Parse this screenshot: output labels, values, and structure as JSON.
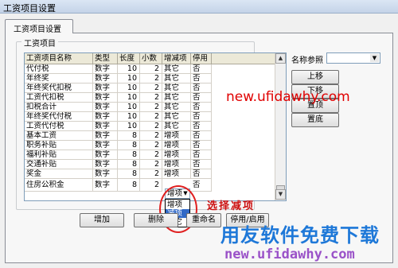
{
  "window": {
    "title": "工资项目设置"
  },
  "tab": {
    "label": "工资项目设置"
  },
  "group": {
    "legend": "工资项目"
  },
  "table": {
    "headers": [
      "工资项目名称",
      "类型",
      "长度",
      "小数",
      "增减项",
      "停用"
    ],
    "rows": [
      [
        "代付税",
        "数字",
        "10",
        "2",
        "其它",
        "否"
      ],
      [
        "年终奖",
        "数字",
        "10",
        "2",
        "其它",
        "否"
      ],
      [
        "年终奖代扣税",
        "数字",
        "10",
        "2",
        "其它",
        "否"
      ],
      [
        "工资代扣税",
        "数字",
        "10",
        "2",
        "其它",
        "否"
      ],
      [
        "扣税合计",
        "数字",
        "10",
        "2",
        "其它",
        "否"
      ],
      [
        "年终奖代付税",
        "数字",
        "10",
        "2",
        "其它",
        "否"
      ],
      [
        "工资代付税",
        "数字",
        "10",
        "2",
        "其它",
        "否"
      ],
      [
        "基本工资",
        "数字",
        "8",
        "2",
        "增项",
        "否"
      ],
      [
        "职务补贴",
        "数字",
        "8",
        "2",
        "增项",
        "否"
      ],
      [
        "福利补贴",
        "数字",
        "8",
        "2",
        "增项",
        "否"
      ],
      [
        "交通补贴",
        "数字",
        "8",
        "2",
        "增项",
        "否"
      ],
      [
        "奖金",
        "数字",
        "8",
        "2",
        "增项",
        "否"
      ],
      [
        "住房公积金",
        "数字",
        "8",
        "2",
        "增项",
        "否"
      ]
    ]
  },
  "dropdown": {
    "current": "增项",
    "options": [
      "增项",
      "减项",
      "其它"
    ],
    "highlighted_index": 1
  },
  "annotation": "选择减项",
  "right_panel": {
    "ref_label": "名称参照",
    "ref_value": "",
    "buttons": [
      "上移",
      "下移",
      "置顶",
      "置底"
    ]
  },
  "bottom_buttons": [
    "增加",
    "删除",
    "重命名",
    "停用/启用"
  ],
  "watermark": {
    "url_top": "new.ufidawhy.com",
    "slogan": "用友软件免费下载",
    "url_bottom": "new.ufidawhy.com"
  }
}
